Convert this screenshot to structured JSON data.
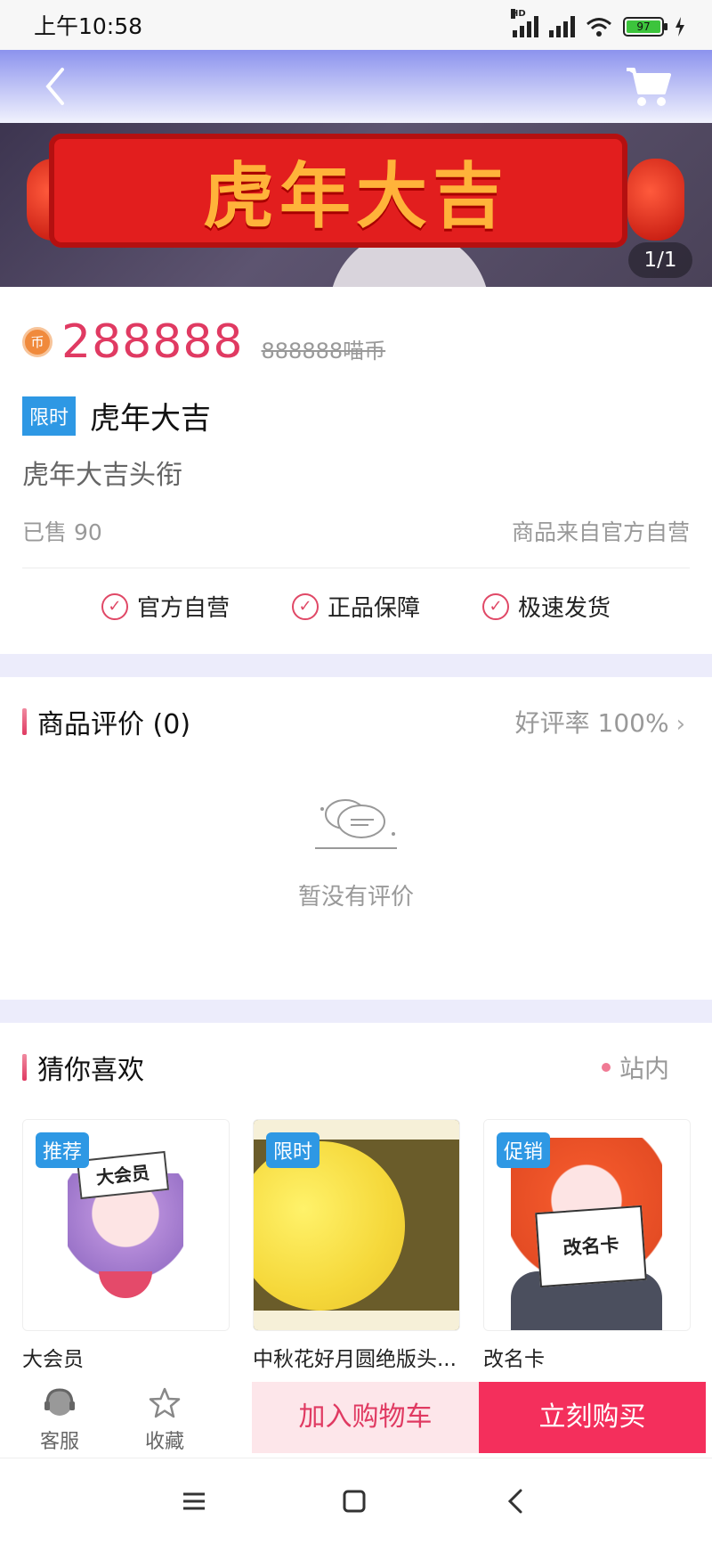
{
  "status_bar": {
    "time": "上午10:58",
    "battery": "97",
    "network": "HD"
  },
  "header": {
    "back_icon": "chevron-left-icon",
    "cart_icon": "shopping-cart-icon"
  },
  "banner": {
    "image_text": "虎年大吉",
    "counter": "1/1"
  },
  "product": {
    "coin_icon": "币",
    "price": "288888",
    "original_price": "888888喵币",
    "tag": "限时",
    "title": "虎年大吉",
    "subtitle": "虎年大吉头衔",
    "sold": "已售 90",
    "source": "商品来自官方自营",
    "guarantees": [
      "官方自营",
      "正品保障",
      "极速发货"
    ]
  },
  "reviews": {
    "title": "商品评价 (0)",
    "rate": "好评率 100%",
    "empty_text": "暂没有评价"
  },
  "recommendations": {
    "title": "猜你喜欢",
    "scope": "站内",
    "items": [
      {
        "badge": "推荐",
        "name": "大会员",
        "art_text": "大会员"
      },
      {
        "badge": "限时",
        "name": "中秋花好月圆绝版头...",
        "art_text": ""
      },
      {
        "badge": "促销",
        "name": "改名卡",
        "art_text": "改名卡"
      }
    ]
  },
  "action_bar": {
    "service_label": "客服",
    "favorite_label": "收藏",
    "add_to_cart": "加入购物车",
    "buy_now": "立刻购买"
  },
  "colors": {
    "accent": "#e03a62",
    "buy": "#f42f5c",
    "tag": "#2e98e4",
    "header_top": "#8c93ee"
  }
}
